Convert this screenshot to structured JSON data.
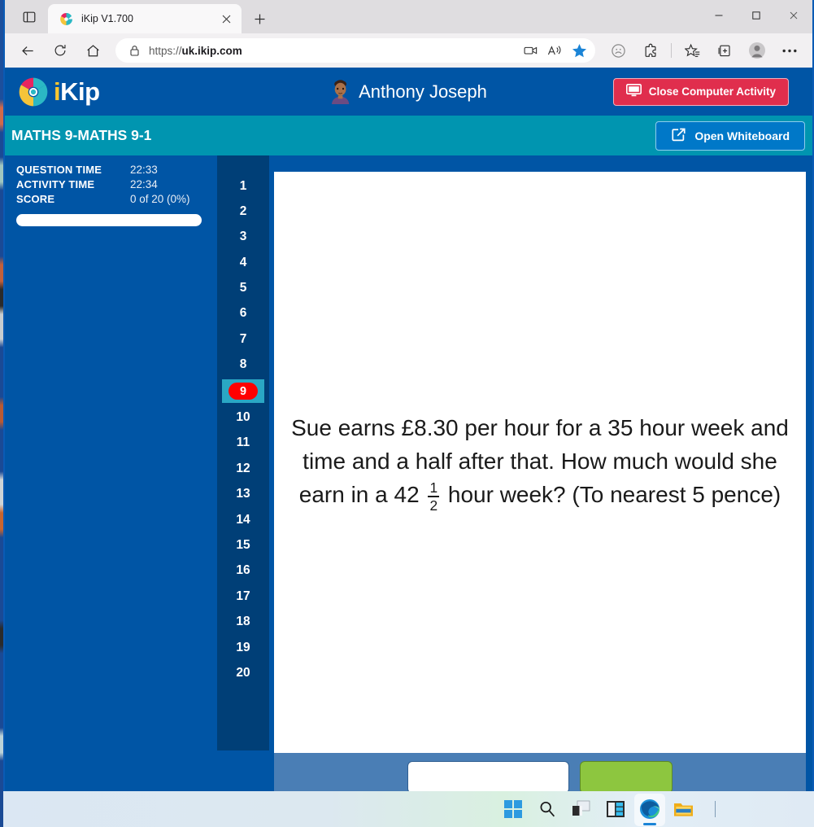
{
  "browser": {
    "tab": {
      "title": "iKip V1.700",
      "favicon_icon": "ikip-pinwheel-icon",
      "close_icon": "close-icon"
    },
    "new_tab_icon": "plus-icon",
    "tab_search_icon": "tab-search-icon",
    "window_controls": {
      "minimize": "minimize-icon",
      "maximize": "maximize-icon",
      "close": "close-icon"
    },
    "nav": {
      "back_icon": "back-arrow-icon",
      "reload_icon": "reload-icon",
      "home_icon": "home-icon",
      "lock_icon": "lock-icon",
      "url_prefix": "https://",
      "url_domain": "uk.ikip.com",
      "url_full": "https://uk.ikip.com",
      "screenshot_icon": "screen-capture-icon",
      "read_aloud_icon": "read-aloud-icon",
      "favorite_icon": "star-filled-icon",
      "copilot_icon": "copilot-icon",
      "extensions_icon": "extensions-icon",
      "favorites_icon": "favorites-star-list-icon",
      "collections_icon": "collections-icon",
      "profile_icon": "profile-avatar-icon",
      "settings_icon": "more-options-icon"
    }
  },
  "app": {
    "logo_text_i": "i",
    "logo_text_rest": "Kip",
    "logo_icon": "ikip-pinwheel-logo",
    "user": {
      "name": "Anthony Joseph",
      "avatar_icon": "user-avatar-icon"
    },
    "close_activity": {
      "label": "Close Computer Activity",
      "icon": "monitor-icon",
      "color": "#e02e4d"
    },
    "subject_title": "MATHS 9-MATHS 9-1",
    "open_whiteboard": {
      "label": "Open Whiteboard",
      "icon": "external-link-icon",
      "color": "#0078c8"
    },
    "stats": [
      {
        "label": "QUESTION TIME",
        "value": "22:33"
      },
      {
        "label": "ACTIVITY TIME",
        "value": "22:34"
      },
      {
        "label": "SCORE",
        "value": "0 of 20 (0%)"
      }
    ],
    "progress_percent": 0,
    "question_numbers": [
      "1",
      "2",
      "3",
      "4",
      "5",
      "6",
      "7",
      "8",
      "9",
      "10",
      "11",
      "12",
      "13",
      "14",
      "15",
      "16",
      "17",
      "18",
      "19",
      "20"
    ],
    "active_question": "9",
    "question": {
      "part1": "Sue earns £8.30 per hour for a 35 hour week and time and a half after that. How much would she earn in a 42",
      "frac_numerator": "1",
      "frac_denominator": "2",
      "part2": "hour week? (To nearest 5 pence)"
    },
    "answer": {
      "input_value": "",
      "input_placeholder": "",
      "submit_label": ""
    }
  },
  "taskbar": {
    "icons": [
      {
        "name": "start-button-icon",
        "label": "Start"
      },
      {
        "name": "search-icon",
        "label": "Search"
      },
      {
        "name": "task-view-icon",
        "label": "Task View"
      },
      {
        "name": "widgets-icon",
        "label": "Widgets"
      },
      {
        "name": "edge-browser-icon",
        "label": "Microsoft Edge"
      },
      {
        "name": "file-explorer-icon",
        "label": "File Explorer"
      }
    ]
  },
  "colors": {
    "brand_blue": "#0055a5",
    "teal": "#0095b0",
    "navy": "#003f77",
    "red_accent": "#e02e4d",
    "green_accent": "#8dc63f",
    "active_pill": "#ff0000",
    "active_highlight": "#2aa7c4"
  }
}
